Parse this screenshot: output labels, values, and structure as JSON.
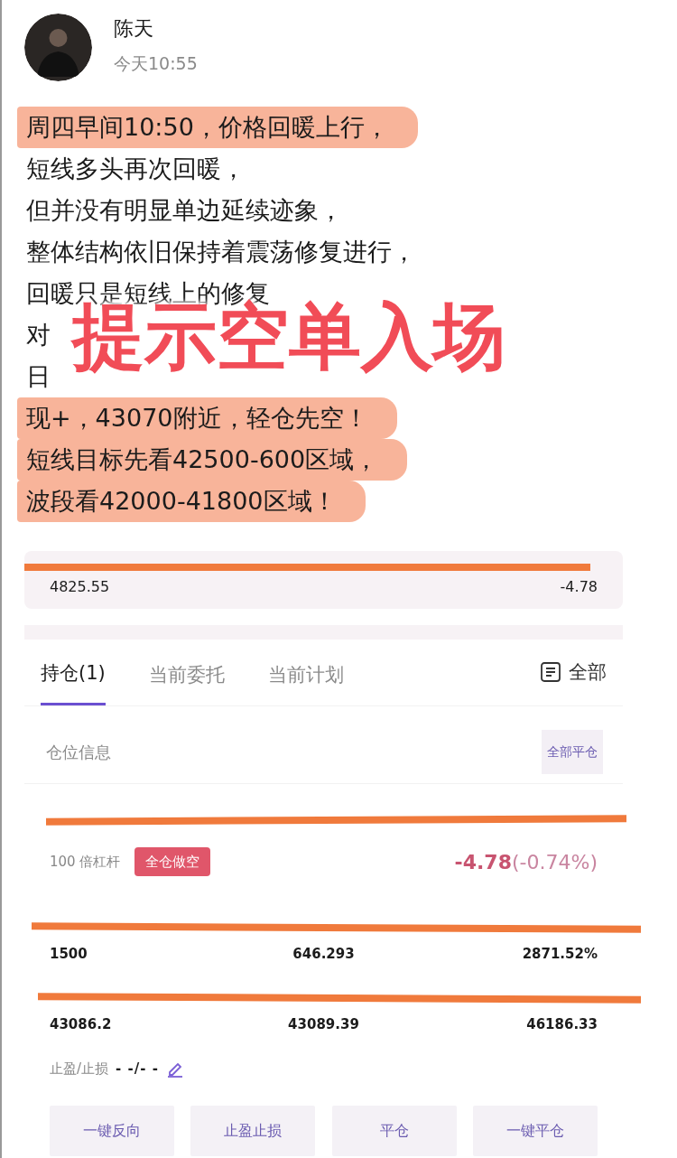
{
  "author": {
    "name": "陈天",
    "time": "今天10:55"
  },
  "post": {
    "lines": [
      {
        "segments": [
          "周四早间10:50，价格回暖上行，"
        ],
        "highlighted": true
      },
      {
        "segments": [
          "短线多头再次回暖，"
        ],
        "highlighted": false
      },
      {
        "segments": [
          "但并没有明显单边延续迹象，"
        ],
        "highlighted": false
      },
      {
        "segments": [
          "整体结构依旧保持着震荡修复进行，"
        ],
        "highlighted": false
      },
      {
        "segments": [
          "回暖只是短线上的修复"
        ],
        "highlighted": false
      },
      {
        "segments": [
          "对"
        ],
        "highlighted": false
      },
      {
        "segments": [
          "日"
        ],
        "highlighted": false
      },
      {
        "segments": [
          "现+，43070附近，轻仓先空！"
        ],
        "highlighted": true
      },
      {
        "segments": [
          "短线目标先看42500-600区域，"
        ],
        "highlighted": true
      },
      {
        "segments": [
          "波段看42000-41800区域！"
        ],
        "highlighted": true
      }
    ],
    "overlay": "提示空单入场"
  },
  "trading": {
    "account_values": [
      "4825.55",
      "-4.78"
    ],
    "tabs": [
      {
        "label": "持仓(1)",
        "selected": true
      },
      {
        "label": "当前委托",
        "selected": false
      },
      {
        "label": "当前计划",
        "selected": false
      }
    ],
    "filter": "全部",
    "section_title": "仓位信息",
    "close_all": "全部平仓",
    "position": {
      "leverage": "100 倍杠杆",
      "mode": "全仓做空",
      "pnl": "-4.78",
      "pnl_pct": "(-0.74%)",
      "rows": [
        [
          "1500",
          "646.293",
          "2871.52%"
        ],
        [
          "43086.2",
          "43089.39",
          "46186.33"
        ]
      ],
      "tp_sl_label": "止盈/止损",
      "tp_sl_value": "- -/- -"
    },
    "actions": [
      "一键反向",
      "止盈止损",
      "平仓",
      "一键平仓"
    ]
  }
}
